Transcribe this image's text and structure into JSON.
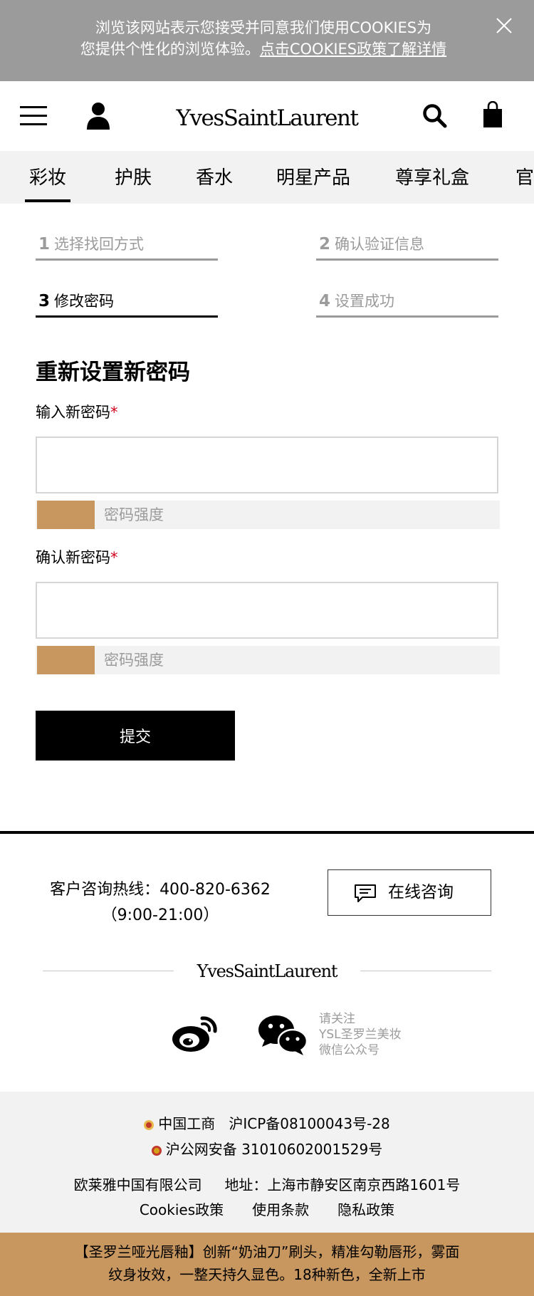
{
  "cookie_bar": {
    "line1": "浏览该网站表示您接受并同意我们使用COOKIES为",
    "line2_prefix": "您提供个性化的浏览体验。",
    "line2_link": "点击COOKIES政策了解详情"
  },
  "header": {
    "brand": "YvesSaintLaurent"
  },
  "nav": {
    "items": [
      "彩妆",
      "护肤",
      "香水",
      "明星产品",
      "尊享礼盒",
      "官"
    ],
    "active_index": 0
  },
  "steps": [
    {
      "num": "1",
      "label": "选择找回方式",
      "active": false
    },
    {
      "num": "2",
      "label": "确认验证信息",
      "active": false
    },
    {
      "num": "3",
      "label": "修改密码",
      "active": true
    },
    {
      "num": "4",
      "label": "设置成功",
      "active": false
    }
  ],
  "form": {
    "title": "重新设置新密码",
    "new_password_label": "输入新密码",
    "confirm_password_label": "确认新密码",
    "required_mark": "*",
    "new_password_value": "",
    "confirm_password_value": "",
    "strength_label": "密码强度",
    "strength_level": 0.125,
    "submit_label": "提交"
  },
  "footer": {
    "hotline_label": "客户咨询热线：400-820-6362",
    "hotline_hours": "（9:00-21:00）",
    "chat_label": "在线咨询",
    "brand": "YvesSaintLaurent",
    "follow_line1": "请关注",
    "follow_line2": "YSL圣罗兰美妆",
    "follow_line3": "微信公众号"
  },
  "legal": {
    "icp_org": "中国工商",
    "icp": "沪ICP备08100043号-28",
    "police": "沪公网安备 31010602001529号",
    "company": "欧莱雅中国有限公司",
    "address": "地址：上海市静安区南京西路1601号",
    "links": [
      "Cookies政策",
      "使用条款",
      "隐私政策"
    ]
  },
  "promo": {
    "line1": "【圣罗兰哑光唇釉】创新“奶油刀”刷头，精准勾勒唇形，雾面",
    "line2": "纹身妆效，一整天持久显色。18种新色，全新上市"
  },
  "colors": {
    "cookie_bg": "#9b9b9b",
    "nav_bg": "#f2f2f2",
    "accent": "#c8965f",
    "required": "#d0021b"
  }
}
